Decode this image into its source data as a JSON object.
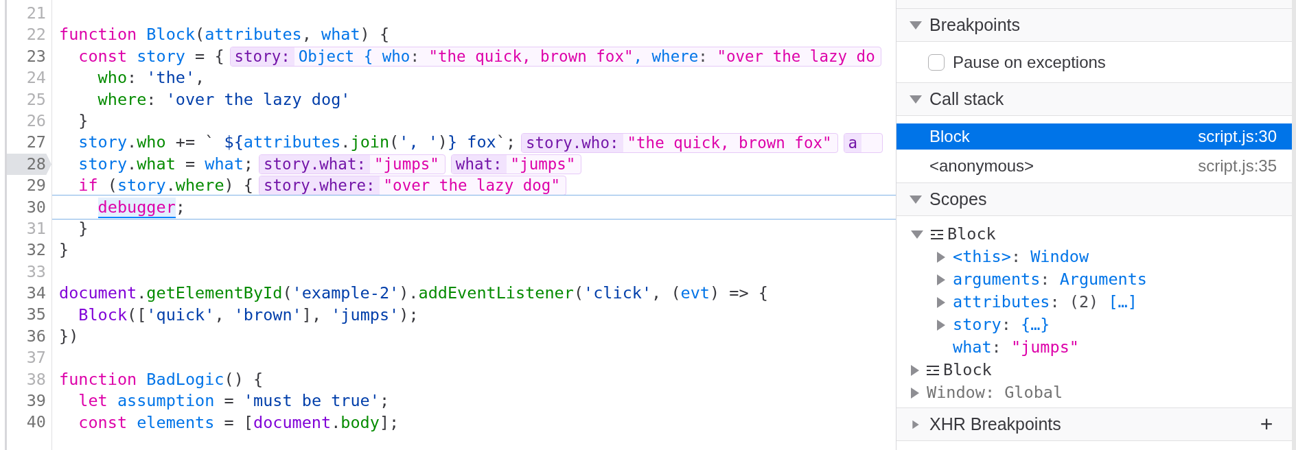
{
  "editor": {
    "lines": [
      {
        "number": "21",
        "breakable": false,
        "breakpoint": false,
        "paused": false
      },
      {
        "number": "22",
        "breakable": false,
        "breakpoint": false,
        "paused": false,
        "tokens": [
          {
            "text": "function",
            "kind": "keyword"
          },
          {
            "text": " Block",
            "kind": "identifier"
          },
          {
            "text": "(",
            "kind": "plain"
          },
          {
            "text": "attributes",
            "kind": "identifier"
          },
          {
            "text": ", ",
            "kind": "plain"
          },
          {
            "text": "what",
            "kind": "identifier"
          },
          {
            "text": ") {",
            "kind": "plain"
          }
        ]
      },
      {
        "number": "23",
        "breakable": true,
        "breakpoint": false,
        "paused": false,
        "tokens": [
          {
            "text": "  const",
            "kind": "keyword"
          },
          {
            "text": " story",
            "kind": "identifier"
          },
          {
            "text": " = {",
            "kind": "plain"
          }
        ],
        "previews": [
          {
            "label": "story:",
            "value": [
              {
                "text": "Object { ",
                "kind": "object"
              },
              {
                "text": "who",
                "kind": "key"
              },
              {
                "text": ": ",
                "kind": "punct"
              },
              {
                "text": "\"the quick, brown fox\"",
                "kind": "string"
              },
              {
                "text": ", ",
                "kind": "object"
              },
              {
                "text": "where",
                "kind": "key"
              },
              {
                "text": ": ",
                "kind": "punct"
              },
              {
                "text": "\"over the lazy do",
                "kind": "string"
              }
            ]
          }
        ]
      },
      {
        "number": "24",
        "breakable": false,
        "breakpoint": false,
        "paused": false,
        "tokens": [
          {
            "text": "    who",
            "kind": "property"
          },
          {
            "text": ": ",
            "kind": "plain"
          },
          {
            "text": "'the'",
            "kind": "literal"
          },
          {
            "text": ",",
            "kind": "plain"
          }
        ]
      },
      {
        "number": "25",
        "breakable": false,
        "breakpoint": false,
        "paused": false,
        "tokens": [
          {
            "text": "    where",
            "kind": "property"
          },
          {
            "text": ": ",
            "kind": "plain"
          },
          {
            "text": "'over the lazy dog'",
            "kind": "literal"
          }
        ]
      },
      {
        "number": "26",
        "breakable": false,
        "breakpoint": false,
        "paused": false,
        "tokens": [
          {
            "text": "  }",
            "kind": "plain"
          }
        ]
      },
      {
        "number": "27",
        "breakable": true,
        "breakpoint": false,
        "paused": false,
        "tokens": [
          {
            "text": "  story",
            "kind": "identifier"
          },
          {
            "text": ".",
            "kind": "plain"
          },
          {
            "text": "who",
            "kind": "property"
          },
          {
            "text": " += ` ",
            "kind": "plain"
          },
          {
            "text": "${",
            "kind": "literal"
          },
          {
            "text": "attributes",
            "kind": "identifier"
          },
          {
            "text": ".",
            "kind": "plain"
          },
          {
            "text": "join",
            "kind": "property"
          },
          {
            "text": "(",
            "kind": "plain"
          },
          {
            "text": "', '",
            "kind": "literal"
          },
          {
            "text": ")",
            "kind": "plain"
          },
          {
            "text": "} fox",
            "kind": "literal"
          },
          {
            "text": "`;",
            "kind": "plain"
          }
        ],
        "previews": [
          {
            "label": "story.who:",
            "value": [
              {
                "text": "\"the quick, brown fox\"",
                "kind": "string"
              }
            ]
          },
          {
            "label": "a"
          }
        ]
      },
      {
        "number": "28",
        "breakable": true,
        "breakpoint": true,
        "paused": false,
        "tokens": [
          {
            "text": "  story",
            "kind": "identifier"
          },
          {
            "text": ".",
            "kind": "plain"
          },
          {
            "text": "what",
            "kind": "property"
          },
          {
            "text": " = ",
            "kind": "plain"
          },
          {
            "text": "what",
            "kind": "identifier"
          },
          {
            "text": ";",
            "kind": "plain"
          }
        ],
        "previews": [
          {
            "label": "story.what:",
            "value": [
              {
                "text": "\"jumps\"",
                "kind": "string"
              }
            ]
          },
          {
            "label": "what:",
            "value": [
              {
                "text": "\"jumps\"",
                "kind": "string"
              }
            ]
          }
        ]
      },
      {
        "number": "29",
        "breakable": true,
        "breakpoint": false,
        "paused": false,
        "tokens": [
          {
            "text": "  if",
            "kind": "keyword"
          },
          {
            "text": " (",
            "kind": "plain"
          },
          {
            "text": "story",
            "kind": "identifier"
          },
          {
            "text": ".",
            "kind": "plain"
          },
          {
            "text": "where",
            "kind": "property"
          },
          {
            "text": ") {",
            "kind": "plain"
          }
        ],
        "previews": [
          {
            "label": "story.where:",
            "value": [
              {
                "text": "\"over the lazy dog\"",
                "kind": "string"
              }
            ]
          }
        ]
      },
      {
        "number": "30",
        "breakable": true,
        "breakpoint": false,
        "paused": true,
        "tokens": [
          {
            "text": "    debugger",
            "kind": "keyword"
          },
          {
            "text": ";",
            "kind": "plain"
          }
        ]
      },
      {
        "number": "31",
        "breakable": false,
        "breakpoint": false,
        "paused": false,
        "tokens": [
          {
            "text": "  }",
            "kind": "plain"
          }
        ]
      },
      {
        "number": "32",
        "breakable": true,
        "breakpoint": false,
        "paused": false,
        "tokens": [
          {
            "text": "}",
            "kind": "plain"
          }
        ]
      },
      {
        "number": "33",
        "breakable": false,
        "breakpoint": false,
        "paused": false
      },
      {
        "number": "34",
        "breakable": true,
        "breakpoint": false,
        "paused": false,
        "tokens": [
          {
            "text": "document",
            "kind": "global"
          },
          {
            "text": ".",
            "kind": "plain"
          },
          {
            "text": "getElementById",
            "kind": "property"
          },
          {
            "text": "(",
            "kind": "plain"
          },
          {
            "text": "'example-2'",
            "kind": "literal"
          },
          {
            "text": ").",
            "kind": "plain"
          },
          {
            "text": "addEventListener",
            "kind": "property"
          },
          {
            "text": "(",
            "kind": "plain"
          },
          {
            "text": "'click'",
            "kind": "literal"
          },
          {
            "text": ", (",
            "kind": "plain"
          },
          {
            "text": "evt",
            "kind": "identifier"
          },
          {
            "text": ") => {",
            "kind": "plain"
          }
        ]
      },
      {
        "number": "35",
        "breakable": true,
        "breakpoint": false,
        "paused": false,
        "tokens": [
          {
            "text": "  Block",
            "kind": "global"
          },
          {
            "text": "([",
            "kind": "plain"
          },
          {
            "text": "'quick'",
            "kind": "literal"
          },
          {
            "text": ", ",
            "kind": "plain"
          },
          {
            "text": "'brown'",
            "kind": "literal"
          },
          {
            "text": "], ",
            "kind": "plain"
          },
          {
            "text": "'jumps'",
            "kind": "literal"
          },
          {
            "text": ");",
            "kind": "plain"
          }
        ]
      },
      {
        "number": "36",
        "breakable": true,
        "breakpoint": false,
        "paused": false,
        "tokens": [
          {
            "text": "})",
            "kind": "plain"
          }
        ]
      },
      {
        "number": "37",
        "breakable": false,
        "breakpoint": false,
        "paused": false
      },
      {
        "number": "38",
        "breakable": false,
        "breakpoint": false,
        "paused": false,
        "tokens": [
          {
            "text": "function",
            "kind": "keyword"
          },
          {
            "text": " BadLogic",
            "kind": "identifier"
          },
          {
            "text": "() {",
            "kind": "plain"
          }
        ]
      },
      {
        "number": "39",
        "breakable": true,
        "breakpoint": false,
        "paused": false,
        "tokens": [
          {
            "text": "  let",
            "kind": "keyword"
          },
          {
            "text": " assumption",
            "kind": "identifier"
          },
          {
            "text": " = ",
            "kind": "plain"
          },
          {
            "text": "'must be true'",
            "kind": "literal"
          },
          {
            "text": ";",
            "kind": "plain"
          }
        ]
      },
      {
        "number": "40",
        "breakable": true,
        "breakpoint": false,
        "paused": false,
        "tokens": [
          {
            "text": "  const",
            "kind": "keyword"
          },
          {
            "text": " elements",
            "kind": "identifier"
          },
          {
            "text": " = [",
            "kind": "plain"
          },
          {
            "text": "document",
            "kind": "global"
          },
          {
            "text": ".",
            "kind": "plain"
          },
          {
            "text": "body",
            "kind": "property"
          },
          {
            "text": "];",
            "kind": "plain"
          }
        ]
      }
    ]
  },
  "sidebar": {
    "sections": [
      {
        "kind": "breakpoints",
        "title": "Breakpoints",
        "expanded": true,
        "pause_on_exceptions": {
          "label": "Pause on exceptions",
          "checked": false
        }
      },
      {
        "kind": "callstack",
        "title": "Call stack",
        "expanded": true,
        "frames": [
          {
            "name": "Block",
            "location": "script.js:30",
            "selected": true
          },
          {
            "name": "<anonymous>",
            "location": "script.js:35",
            "selected": false
          }
        ]
      },
      {
        "kind": "scopes",
        "title": "Scopes",
        "expanded": true,
        "items": [
          {
            "kind": "scope",
            "name": "Block",
            "expandable": true,
            "expanded": true,
            "children": [
              {
                "kind": "variable",
                "name": "<this>",
                "expandable": true,
                "expanded": false,
                "value": [
                  {
                    "text": ": ",
                    "kind": "punct"
                  },
                  {
                    "text": "Window",
                    "kind": "object"
                  }
                ]
              },
              {
                "kind": "variable",
                "name": "arguments",
                "expandable": true,
                "expanded": false,
                "value": [
                  {
                    "text": ": ",
                    "kind": "punct"
                  },
                  {
                    "text": "Arguments",
                    "kind": "object"
                  }
                ]
              },
              {
                "kind": "variable",
                "name": "attributes",
                "expandable": true,
                "expanded": false,
                "value": [
                  {
                    "text": ": ",
                    "kind": "punct"
                  },
                  {
                    "text": "(2) ",
                    "kind": "punct"
                  },
                  {
                    "text": "[…]",
                    "kind": "object"
                  }
                ]
              },
              {
                "kind": "variable",
                "name": "story",
                "expandable": true,
                "expanded": false,
                "value": [
                  {
                    "text": ": ",
                    "kind": "punct"
                  },
                  {
                    "text": "{…}",
                    "kind": "object"
                  }
                ]
              },
              {
                "kind": "variable",
                "name": "what",
                "expandable": false,
                "value": [
                  {
                    "text": ": ",
                    "kind": "punct"
                  },
                  {
                    "text": "\"jumps\"",
                    "kind": "string"
                  }
                ]
              }
            ]
          },
          {
            "kind": "scope",
            "name": "Block",
            "expandable": true,
            "expanded": false
          },
          {
            "kind": "global",
            "name": "Window",
            "expandable": true,
            "expanded": false,
            "value": [
              {
                "text": ": Global",
                "kind": "dim"
              }
            ]
          }
        ]
      },
      {
        "kind": "xhr",
        "title": "XHR Breakpoints",
        "expanded": false,
        "add_button": "+"
      }
    ]
  }
}
